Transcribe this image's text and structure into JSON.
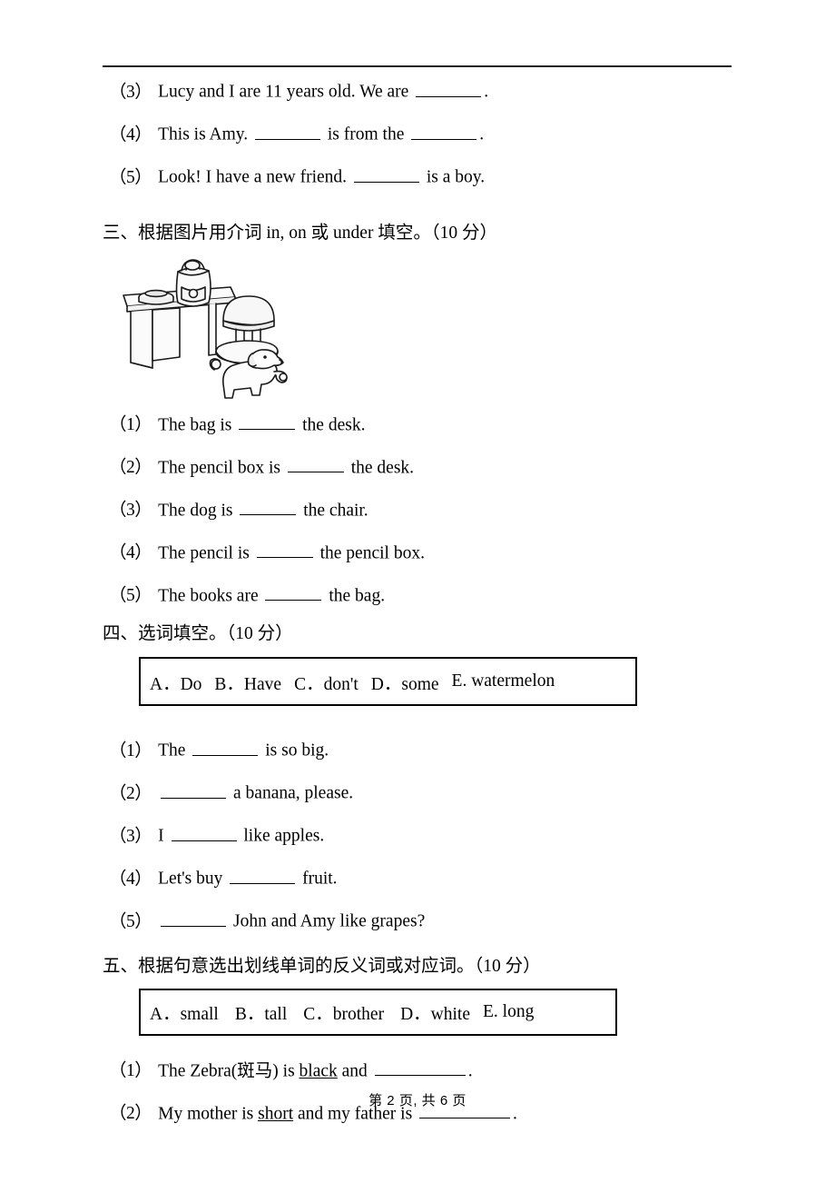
{
  "document": {
    "footer": "第 2 页, 共 6 页"
  },
  "carryover_items": [
    {
      "num": "（3）",
      "parts": [
        "Lucy and I are 11 years old. We are ",
        "BLANK_MD",
        "."
      ]
    },
    {
      "num": "（4）",
      "parts": [
        "This is Amy. ",
        "BLANK_MD",
        " is from the ",
        "BLANK_MD",
        "."
      ]
    },
    {
      "num": "（5）",
      "parts": [
        "Look! I have a new friend. ",
        "BLANK_MD",
        " is a boy."
      ]
    }
  ],
  "section3": {
    "heading": "三、根据图片用介词 in, on 或 under 填空。（10 分）",
    "illustration_name": "desk-chair-dog-illustration",
    "items": [
      {
        "num": "（1）",
        "before": "The bag is ",
        "after": " the desk."
      },
      {
        "num": "（2）",
        "before": "The pencil box is ",
        "after": " the desk."
      },
      {
        "num": "（3）",
        "before": "The dog is ",
        "after": " the chair."
      },
      {
        "num": "（4）",
        "before": "The pencil is ",
        "after": " the pencil box."
      },
      {
        "num": "（5）",
        "before": "The books are ",
        "after": " the bag."
      }
    ]
  },
  "section4": {
    "heading": "四、选词填空。（10 分）",
    "wordbank": [
      "A．Do",
      "B．Have",
      "C．don't",
      "D．some",
      "E. watermelon"
    ],
    "items": [
      {
        "num": "（1）",
        "before": "The ",
        "after": " is so big."
      },
      {
        "num": "（2）",
        "before": "",
        "after": " a banana, please."
      },
      {
        "num": "（3）",
        "before": "I ",
        "after": " like apples."
      },
      {
        "num": "（4）",
        "before": "Let's buy ",
        "after": " fruit."
      },
      {
        "num": "（5）",
        "before": "",
        "after": " John and Amy like grapes?"
      }
    ]
  },
  "section5": {
    "heading": "五、根据句意选出划线单词的反义词或对应词。（10 分）",
    "wordbank": [
      "A．small",
      "B．tall",
      "C．brother",
      "D．white",
      "E. long"
    ],
    "items": [
      {
        "num": "（1）",
        "before": "The Zebra(斑马) is ",
        "underlined": "black",
        "middle": " and ",
        "after": "."
      },
      {
        "num": "（2）",
        "before": "My mother is ",
        "underlined": "short",
        "middle": " and my father is ",
        "after": "."
      }
    ]
  }
}
